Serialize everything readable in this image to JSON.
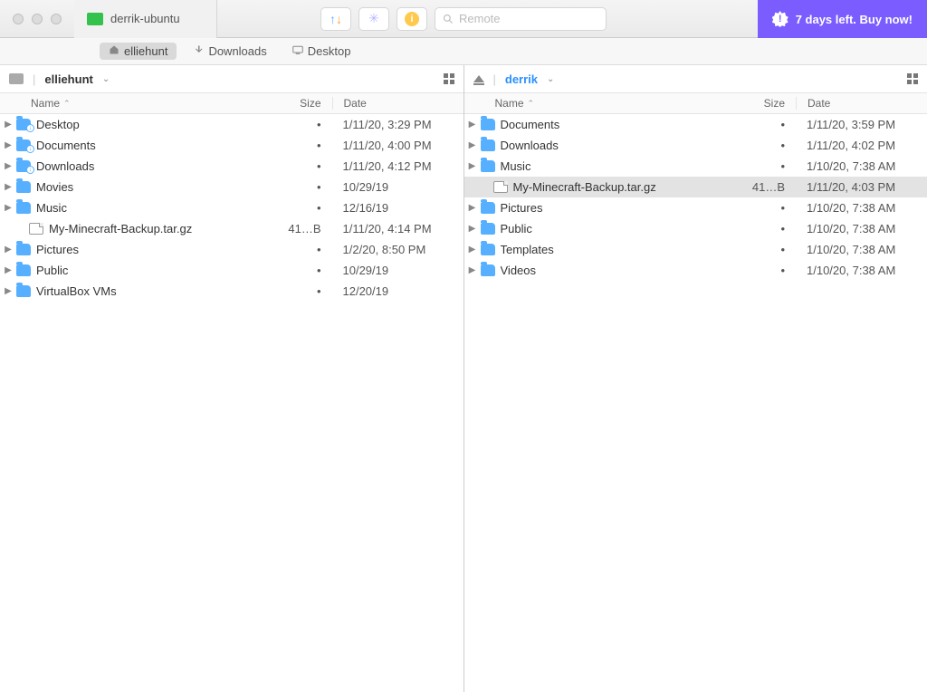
{
  "titlebar": {
    "tab_label": "derrik-ubuntu",
    "search_placeholder": "Remote",
    "buy_text": "7 days left. Buy now!",
    "buy_badge": "!"
  },
  "breadcrumbs": [
    {
      "label": "elliehunt",
      "icon": "home",
      "active": true
    },
    {
      "label": "Downloads",
      "icon": "download",
      "active": false
    },
    {
      "label": "Desktop",
      "icon": "desktop",
      "active": false
    }
  ],
  "columns": {
    "name": "Name",
    "size": "Size",
    "date": "Date"
  },
  "panes": {
    "left": {
      "location": "elliehunt",
      "remote": false,
      "drive_icon": "drive",
      "rows": [
        {
          "type": "folder",
          "name": "Desktop",
          "size": "•",
          "date": "1/11/20, 3:29 PM",
          "sub": true
        },
        {
          "type": "folder",
          "name": "Documents",
          "size": "•",
          "date": "1/11/20, 4:00 PM",
          "sub": true
        },
        {
          "type": "folder",
          "name": "Downloads",
          "size": "•",
          "date": "1/11/20, 4:12 PM",
          "sub": true
        },
        {
          "type": "folder",
          "name": "Movies",
          "size": "•",
          "date": "10/29/19"
        },
        {
          "type": "folder",
          "name": "Music",
          "size": "•",
          "date": "12/16/19"
        },
        {
          "type": "file",
          "name": "My-Minecraft-Backup.tar.gz",
          "size": "41…B",
          "date": "1/11/20, 4:14 PM",
          "indent": true
        },
        {
          "type": "folder",
          "name": "Pictures",
          "size": "•",
          "date": "1/2/20, 8:50 PM"
        },
        {
          "type": "folder",
          "name": "Public",
          "size": "•",
          "date": "10/29/19"
        },
        {
          "type": "folder",
          "name": "VirtualBox VMs",
          "size": "•",
          "date": "12/20/19"
        }
      ]
    },
    "right": {
      "location": "derrik",
      "remote": true,
      "drive_icon": "eject",
      "rows": [
        {
          "type": "folder",
          "name": "Documents",
          "size": "•",
          "date": "1/11/20, 3:59 PM"
        },
        {
          "type": "folder",
          "name": "Downloads",
          "size": "•",
          "date": "1/11/20, 4:02 PM"
        },
        {
          "type": "folder",
          "name": "Music",
          "size": "•",
          "date": "1/10/20, 7:38 AM"
        },
        {
          "type": "file",
          "name": "My-Minecraft-Backup.tar.gz",
          "size": "41…B",
          "date": "1/11/20, 4:03 PM",
          "indent": true,
          "selected": true
        },
        {
          "type": "folder",
          "name": "Pictures",
          "size": "•",
          "date": "1/10/20, 7:38 AM"
        },
        {
          "type": "folder",
          "name": "Public",
          "size": "•",
          "date": "1/10/20, 7:38 AM"
        },
        {
          "type": "folder",
          "name": "Templates",
          "size": "•",
          "date": "1/10/20, 7:38 AM"
        },
        {
          "type": "folder",
          "name": "Videos",
          "size": "•",
          "date": "1/10/20, 7:38 AM"
        }
      ]
    }
  }
}
